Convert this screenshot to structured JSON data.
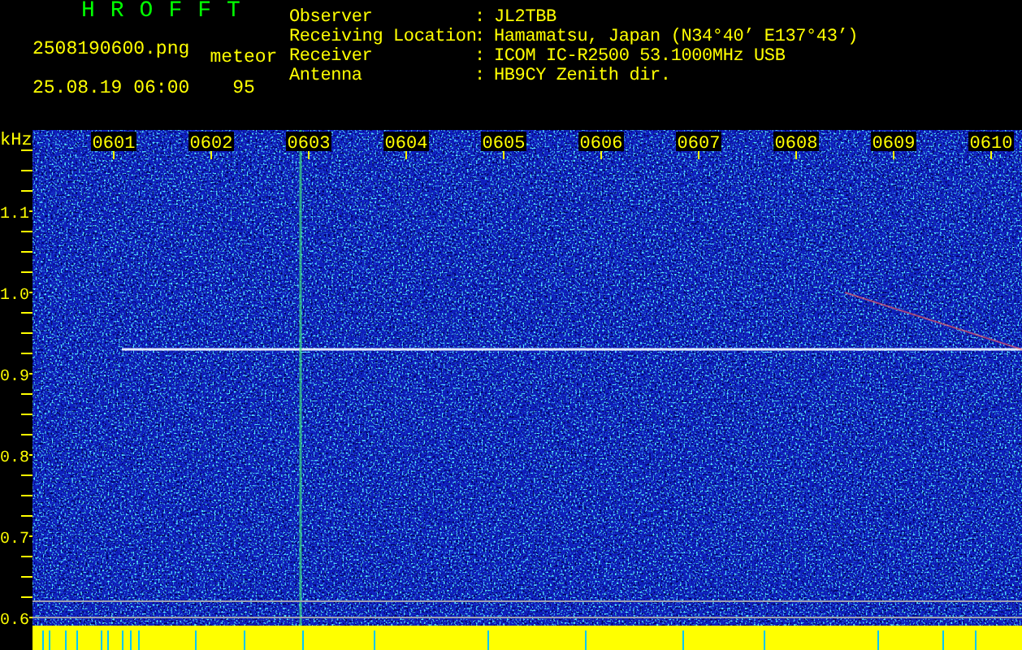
{
  "header": {
    "title": "HROFFT",
    "file_name": "2508190600.png",
    "timestamp": "25.08.19 06:00",
    "count_label": "meteor",
    "count_value": "95"
  },
  "info": [
    {
      "label": "Observer",
      "separator": ":",
      "value": "JL2TBB"
    },
    {
      "label": "Receiving Location",
      "separator": ":",
      "value": "Hamamatsu, Japan (N34°40’ E137°43’)"
    },
    {
      "label": "Receiver",
      "separator": ":",
      "value": "ICOM IC-R2500 53.1000MHz USB"
    },
    {
      "label": "Antenna",
      "separator": ":",
      "value": "HB9CY Zenith dir."
    }
  ],
  "spectrogram": {
    "unit": "kHz",
    "frequency_labels": [
      "1.1",
      "1.0",
      "0.9",
      "0.8",
      "0.7",
      "0.6"
    ],
    "time_labels": [
      "0601",
      "0602",
      "0603",
      "0604",
      "0605",
      "0606",
      "0607",
      "0608",
      "0609",
      "0610"
    ]
  }
}
